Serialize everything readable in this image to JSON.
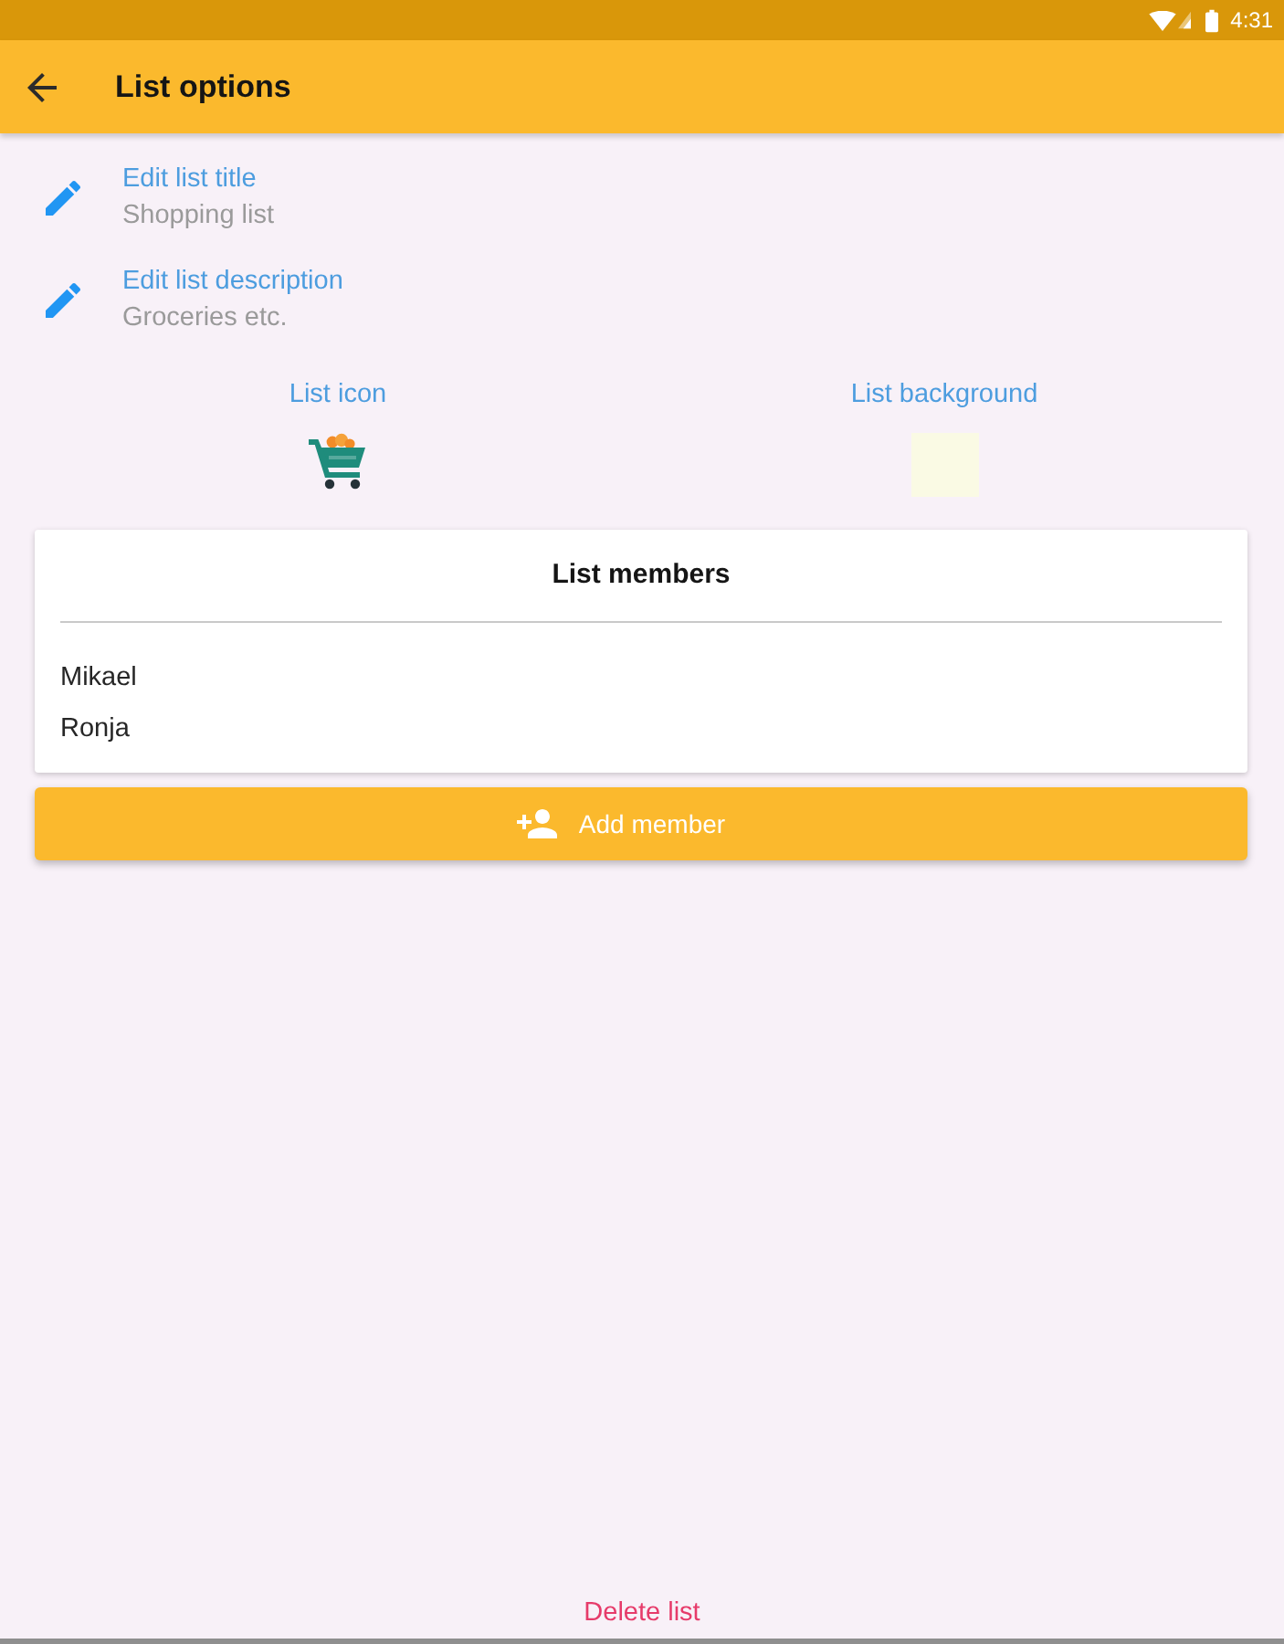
{
  "status_bar": {
    "time": "4:31"
  },
  "app_bar": {
    "title": "List options"
  },
  "edit_rows": [
    {
      "title": "Edit list title",
      "value": "Shopping list"
    },
    {
      "title": "Edit list description",
      "value": "Groceries etc."
    }
  ],
  "pickers": [
    {
      "kind": "icon",
      "label": "List icon"
    },
    {
      "kind": "background",
      "label": "List background"
    }
  ],
  "members": {
    "title": "List members",
    "names": [
      "Mikael",
      "Ronja"
    ]
  },
  "add_button": {
    "label": "Add member"
  },
  "delete_link": {
    "label": "Delete list"
  }
}
